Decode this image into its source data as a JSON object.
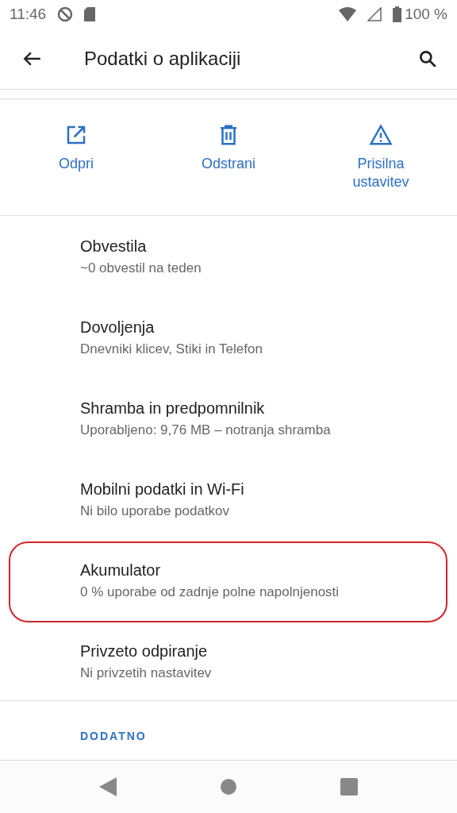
{
  "status_bar": {
    "time": "11:46",
    "battery": "100 %"
  },
  "toolbar": {
    "title": "Podatki o aplikaciji"
  },
  "actions": [
    {
      "kind": "open",
      "label": "Odpri"
    },
    {
      "kind": "delete",
      "label": "Odstrani"
    },
    {
      "kind": "warning",
      "label": "Prisilna ustavitev"
    }
  ],
  "items": [
    {
      "title": "Obvestila",
      "subtitle": "~0 obvestil na teden",
      "highlighted": false
    },
    {
      "title": "Dovoljenja",
      "subtitle": "Dnevniki klicev, Stiki in Telefon",
      "highlighted": false
    },
    {
      "title": "Shramba in predpomnilnik",
      "subtitle": "Uporabljeno: 9,76 MB – notranja shramba",
      "highlighted": false
    },
    {
      "title": "Mobilni podatki in Wi-Fi",
      "subtitle": "Ni bilo uporabe podatkov",
      "highlighted": false
    },
    {
      "title": "Akumulator",
      "subtitle": "0 % uporabe od zadnje polne napolnjenosti",
      "highlighted": true
    },
    {
      "title": "Privzeto odpiranje",
      "subtitle": "Ni privzetih nastavitev",
      "highlighted": false
    }
  ],
  "section": {
    "header": "DODATNO"
  }
}
